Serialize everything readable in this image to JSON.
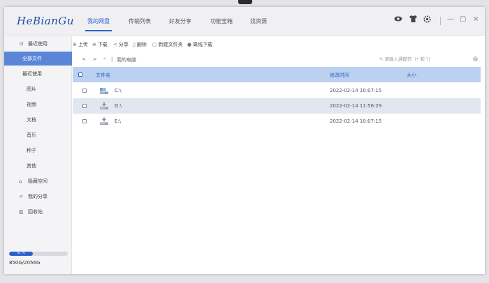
{
  "app": {
    "logo": "HeBianGu"
  },
  "nav": {
    "tabs": [
      {
        "label": "我的网盘",
        "active": true
      },
      {
        "label": "传输列表",
        "active": false
      },
      {
        "label": "好友分享",
        "active": false
      },
      {
        "label": "功能宝箱",
        "active": false
      },
      {
        "label": "找资源",
        "active": false
      }
    ]
  },
  "window_controls": {
    "minimize": "—",
    "maximize": "▢",
    "close": "×"
  },
  "sidebar": {
    "items": [
      {
        "label": "最近使用",
        "icon": "clock-icon",
        "icon_glyph": "⊡"
      },
      {
        "label": "全部文件",
        "active": true
      },
      {
        "label": "最近使用"
      },
      {
        "label": "图片"
      },
      {
        "label": "视频"
      },
      {
        "label": "文档"
      },
      {
        "label": "音乐"
      },
      {
        "label": "种子"
      },
      {
        "label": "其他"
      },
      {
        "label": "隐藏空间",
        "icon": "lock-icon",
        "icon_glyph": "⌂"
      },
      {
        "label": "我的分享",
        "icon": "share-icon",
        "icon_glyph": "<"
      },
      {
        "label": "回收站",
        "icon": "trash-icon",
        "icon_glyph": "▥"
      }
    ],
    "storage": {
      "percent_label": "41 %",
      "percent": 41,
      "usage": "850G/2056G"
    }
  },
  "toolbar": {
    "buttons": [
      {
        "icon": "upload-icon",
        "glyph": "⊕",
        "label": "上传"
      },
      {
        "icon": "download-icon",
        "glyph": "⊕",
        "label": "下载"
      },
      {
        "icon": "share-icon",
        "glyph": "<",
        "label": "分享"
      },
      {
        "icon": "delete-icon",
        "glyph": "▯",
        "label": "删除"
      },
      {
        "icon": "new-folder-icon",
        "glyph": "▢",
        "label": "新建文件夹"
      },
      {
        "icon": "offline-download-icon",
        "glyph": "●",
        "label": "离线下载"
      }
    ]
  },
  "pathbar": {
    "back": "<",
    "forward": ">",
    "dropdown": "⌄",
    "separator": "|",
    "current": "我的电脑",
    "search_placeholder": "✎ 请输入通配符（* 和 ?）",
    "search_clear": "×"
  },
  "table": {
    "headers": {
      "name": "文件名",
      "modified": "修改时间",
      "size": "大小"
    },
    "rows": [
      {
        "name": "C:\\",
        "modified": "2022-02-14 10:07:15",
        "size": "",
        "selected": false
      },
      {
        "name": "D:\\",
        "modified": "2022-02-14 11:56:29",
        "size": "",
        "selected": true
      },
      {
        "name": "E:\\",
        "modified": "2022-02-14 10:07:15",
        "size": "",
        "selected": false
      }
    ]
  },
  "colors": {
    "accent": "#2a62c9",
    "sidebar_active": "#5b86d8",
    "header_bg": "#bcd0ef",
    "row_selected": "#e1e6f0"
  }
}
